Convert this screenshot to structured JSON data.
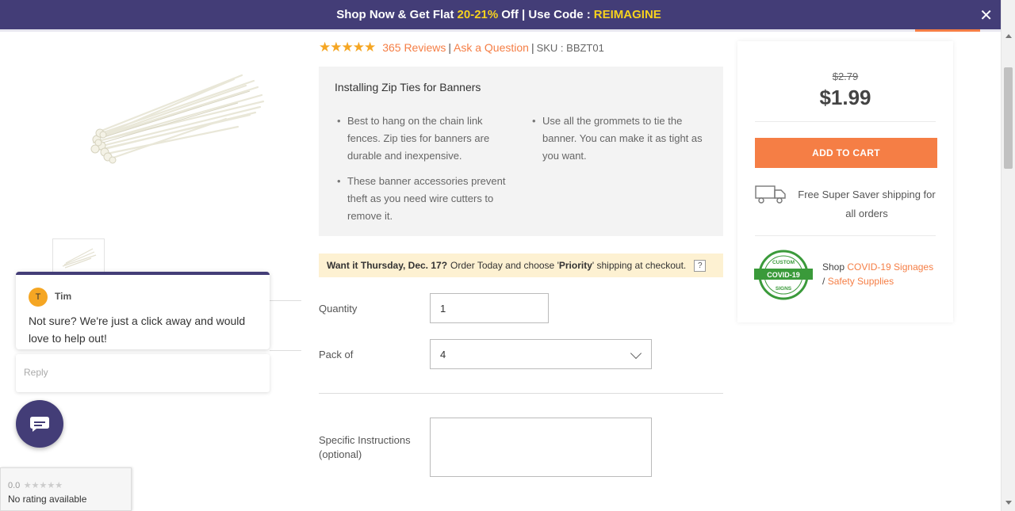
{
  "promo": {
    "prefix": "Shop Now & Get Flat",
    "discount": "20-21%",
    "middle": "Off | Use Code :",
    "code": "REIMAGINE",
    "close_label": "✕"
  },
  "product": {
    "rating_stars": "★★★★★",
    "reviews_link": "365 Reviews",
    "ask_link": "Ask a Question",
    "sku": "SKU : BBZT01"
  },
  "info": {
    "title": "Installing Zip Ties for Banners",
    "bullets_left": [
      "Best to hang on the chain link fences. Zip ties for banners are durable and inexpensive.",
      "These banner accessories prevent theft as you need wire cutters to remove it."
    ],
    "bullets_right": [
      "Use all the grommets to tie the banner. You can make it as tight as you want."
    ]
  },
  "delivery": {
    "bold": "Want it Thursday, Dec. 17?",
    "text_before": "Order Today and choose '",
    "priority": "Priority",
    "text_after": "' shipping at checkout.",
    "help": "?"
  },
  "form": {
    "quantity_label": "Quantity",
    "quantity_value": "1",
    "pack_label": "Pack of",
    "pack_value": "4",
    "instructions_label": "Specific Instructions (optional)"
  },
  "pricing": {
    "old_price": "$2.79",
    "new_price": "$1.99",
    "add_to_cart": "ADD TO CART",
    "shipping_text": "Free Super Saver shipping for all orders",
    "shop_prefix": "Shop",
    "covid_link": "COVID-19 Signages",
    "slash": "/",
    "safety_link": "Safety Supplies",
    "badge_top": "CUSTOM",
    "badge_mid": "COVID-19",
    "badge_bottom": "SIGNS"
  },
  "chat": {
    "avatar_initial": "T",
    "agent_name": "Tim",
    "message": "Not sure? We're just a click away and would love to help out!",
    "reply_placeholder": "Reply"
  },
  "rating_badge": {
    "score": "0.0",
    "stars": "★★★★★",
    "text": "No rating available"
  },
  "colors": {
    "brand_purple": "#433d77",
    "accent_orange": "#f57e45",
    "promo_yellow": "#f7d21e",
    "star_gold": "#f5a623",
    "covid_green": "#3a9a3a"
  }
}
